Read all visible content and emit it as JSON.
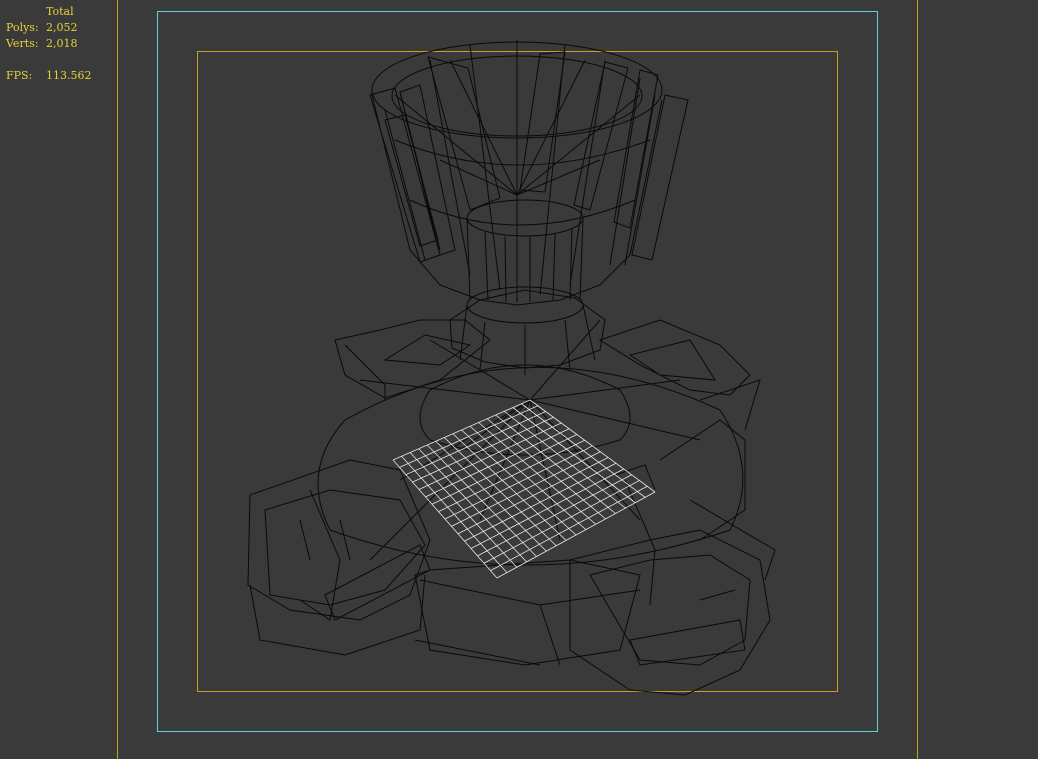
{
  "viewport_stats": {
    "header": "Total",
    "polys_label": "Polys:",
    "polys_value": "2,052",
    "verts_label": "Verts:",
    "verts_value": "2,018",
    "fps_label": "FPS:",
    "fps_value": "113.562"
  },
  "colors": {
    "background": "#3a3a3a",
    "stats_text": "#e6d23a",
    "safe_frame_outer": "#5fd2d8",
    "safe_frame_inner": "#c8a020",
    "viewport_guides": "#c8a020",
    "wireframe": "#0a0a0a",
    "grid": "#e8e8e8"
  }
}
